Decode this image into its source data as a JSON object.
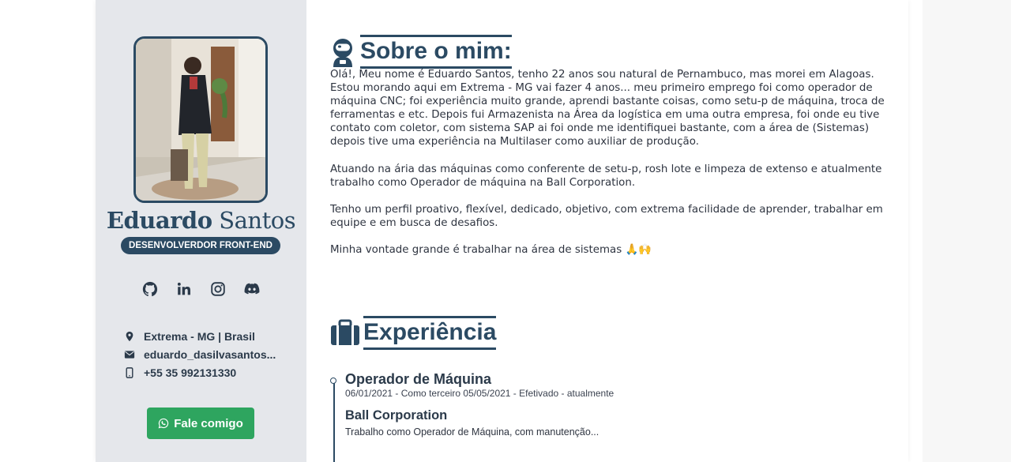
{
  "profile": {
    "first_name": "Eduardo",
    "last_name": "Santos",
    "role": "DESENVOLVERDOR FRONT-END"
  },
  "socials": [
    "github-icon",
    "linkedin-icon",
    "instagram-icon",
    "discord-icon"
  ],
  "contact": {
    "location": "Extrema - MG | Brasil",
    "email": "eduardo_dasilvasantos...",
    "phone": "+55 35 992131330"
  },
  "cta": {
    "label": "Fale comigo"
  },
  "about": {
    "title": "Sobre o mim:",
    "paragraphs": [
      "Olá!, Meu nome é Eduardo Santos, tenho 22 anos sou natural de Pernambuco, mas morei em Alagoas. Estou morando aqui em Extrema - MG vai fazer 4 anos... meu primeiro emprego foi como operador de máquina CNC; foi experiência muito grande, aprendi bastante coisas, como setu-p de máquina, troca de ferramentas e etc. Depois fui Armazenista na Área da logística em uma outra empresa, foi onde eu tive contato com coletor, com sistema SAP ai foi onde me identifiquei bastante, com a área de (Sistemas) depois tive uma experiência na Multilaser como auxiliar de produção.",
      "Atuando na ária das máquinas como conferente de setu-p, rosh lote e limpeza de extenso e atualmente trabalho como Operador de máquina na Ball Corporation.",
      "Tenho um perfil proativo, flexível, dedicado, objetivo, com extrema facilidade de aprender, trabalhar em equipe e em busca de desafios.",
      "Minha vontade grande é trabalhar na área de sistemas 🙏🙌"
    ]
  },
  "experience": {
    "title": "Experiência",
    "jobs": [
      {
        "title": "Operador de Máquina",
        "dates": "06/01/2021 - Como terceiro 05/05/2021 - Efetivado - atualmente",
        "company": "Ball Corporation",
        "description": "Trabalho como Operador de Máquina, com manutenção..."
      }
    ]
  },
  "colors": {
    "accent": "#2b4a63",
    "sidebar_bg": "#e5e7eb",
    "cta_bg": "#2ea55f"
  }
}
